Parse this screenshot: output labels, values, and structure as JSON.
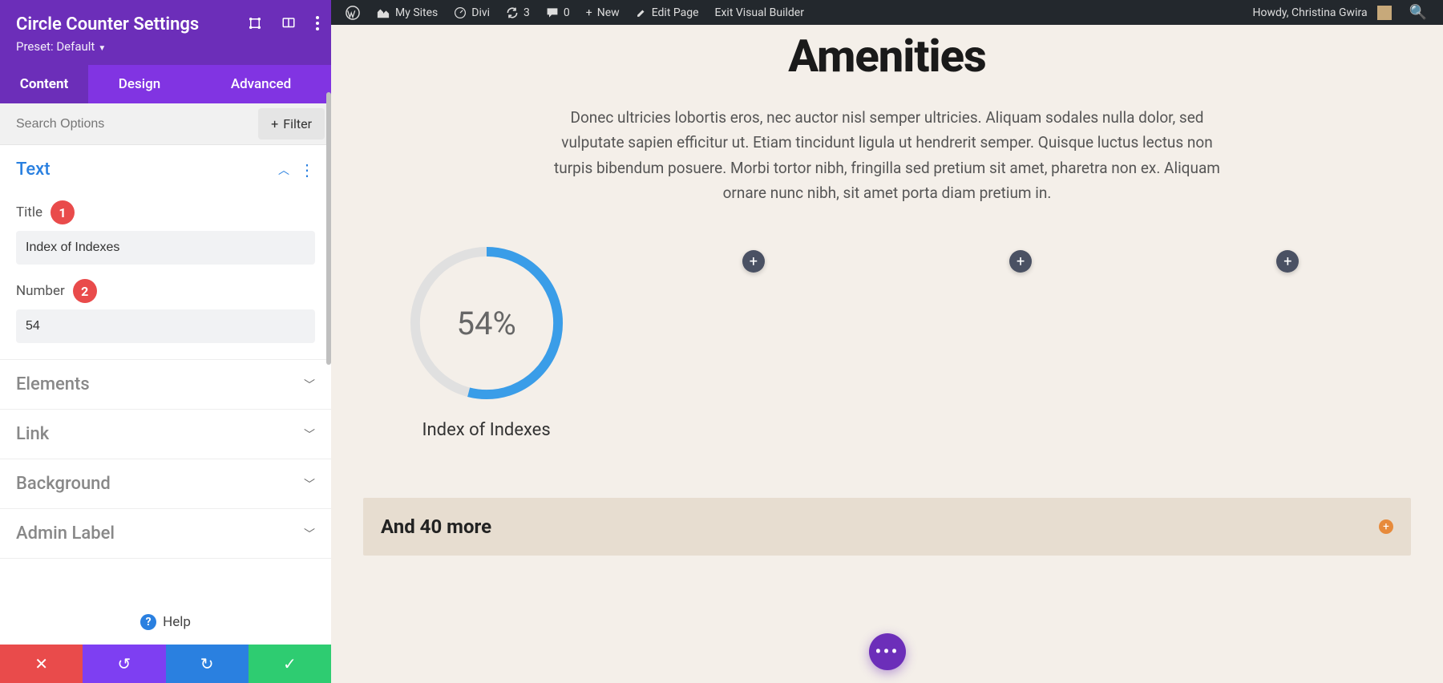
{
  "sidebar": {
    "title": "Circle Counter Settings",
    "preset_prefix": "Preset: ",
    "preset_name": "Default",
    "tabs": [
      "Content",
      "Design",
      "Advanced"
    ],
    "active_tab": 0,
    "search_placeholder": "Search Options",
    "filter_label": "Filter",
    "text_section": {
      "heading": "Text",
      "title_label": "Title",
      "title_badge": "1",
      "title_value": "Index of Indexes",
      "number_label": "Number",
      "number_badge": "2",
      "number_value": "54"
    },
    "collapsed_sections": [
      "Elements",
      "Link",
      "Background",
      "Admin Label"
    ],
    "help_label": "Help",
    "actions": {
      "cancel": "✕",
      "undo": "↺",
      "redo": "↻",
      "save": "✓"
    }
  },
  "wpbar": {
    "items": [
      {
        "icon": "wp",
        "label": ""
      },
      {
        "icon": "sites",
        "label": "My Sites"
      },
      {
        "icon": "gauge",
        "label": "Divi"
      },
      {
        "icon": "refresh",
        "label": "3"
      },
      {
        "icon": "comment",
        "label": "0"
      },
      {
        "icon": "plus",
        "label": "New"
      },
      {
        "icon": "pencil",
        "label": "Edit Page"
      },
      {
        "icon": "",
        "label": "Exit Visual Builder"
      }
    ],
    "greeting": "Howdy, Christina Gwira"
  },
  "preview": {
    "heading": "Amenities",
    "paragraph": "Donec ultricies lobortis eros, nec auctor nisl semper ultricies. Aliquam sodales nulla dolor, sed vulputate sapien efficitur ut. Etiam tincidunt ligula ut hendrerit semper. Quisque luctus lectus non turpis bibendum posuere. Morbi tortor nibh, fringilla sed pretium sit amet, pharetra non ex. Aliquam ornare nunc nibh, sit amet porta diam pretium in.",
    "circle_percent": 54,
    "circle_percent_text": "54%",
    "circle_title": "Index of Indexes",
    "toggle_label": "And 40 more",
    "colors": {
      "accent": "#2a80e0",
      "ring_bg": "#e0e0e0",
      "purple": "#6c2eb9"
    }
  }
}
